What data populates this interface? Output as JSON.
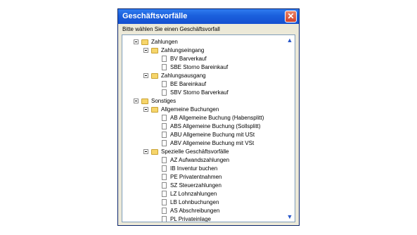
{
  "window": {
    "title": "Geschäftsvorfälle",
    "close_label": "✕"
  },
  "prompt": "Bitte wählen Sie einen Geschäftsvorfall",
  "tree": {
    "zahlungen": "Zahlungen",
    "zahlungseingang": "Zahlungseingang",
    "bv": "BV Barverkauf",
    "sbe": "SBE Storno Bareinkauf",
    "zahlungsausgang": "Zahlungsausgang",
    "be": "BE Bareinkauf",
    "sbv": "SBV Storno Barverkauf",
    "sonstiges": "Sonstiges",
    "allgemeine": "Allgemeine Buchungen",
    "ab": "AB Allgemeine Buchung (Habensplitt)",
    "abs": "ABS Allgemeine Buchung (Sollsplitt)",
    "abu": "ABU Allgemeine Buchung mit USt",
    "abv": "ABV Allgemeine Buchung mit VSt",
    "spezielle": "Spezielle Geschäftsvorfälle",
    "az": "AZ Aufwandszahlungen",
    "ib": "IB Inventur buchen",
    "pe": "PE Privatentnahmen",
    "sz": "SZ Steuerzahlungen",
    "lz": "LZ Lohnzahlungen",
    "lb": "LB Lohnbuchungen",
    "as": "AS Abschreibungen",
    "pl": "PL Privateinlage"
  },
  "icons": {
    "folder": "folder-icon",
    "document": "document-icon",
    "collapse": "collapse-icon",
    "scroll_up": "chevron-up-icon",
    "scroll_down": "chevron-down-icon"
  },
  "colors": {
    "titlebar": "#1a5fdc",
    "close_button": "#d1412a",
    "folder": "#f6d56b",
    "scroll_arrow": "#2a58c8"
  }
}
